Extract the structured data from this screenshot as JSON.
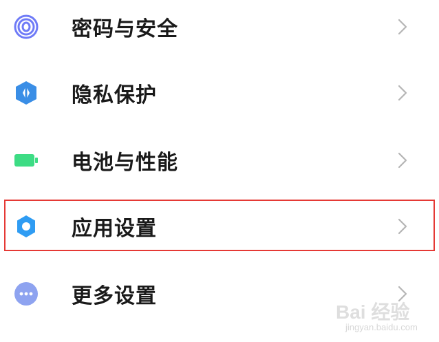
{
  "settings": {
    "items": [
      {
        "label": "密码与安全",
        "icon": "fingerprint-icon",
        "color": "#6f7bf7"
      },
      {
        "label": "隐私保护",
        "icon": "privacy-shield-icon",
        "color": "#3a8ee6"
      },
      {
        "label": "电池与性能",
        "icon": "battery-icon",
        "color": "#3ddc84"
      },
      {
        "label": "应用设置",
        "icon": "gear-icon",
        "color": "#2f9cf3"
      },
      {
        "label": "更多设置",
        "icon": "more-dots-icon",
        "color": "#8ea3f0"
      }
    ],
    "highlighted_item": "应用设置",
    "highlight_color": "#e53935"
  },
  "watermark": {
    "brand": "Bai 经验",
    "url": "jingyan.baidu.com"
  }
}
